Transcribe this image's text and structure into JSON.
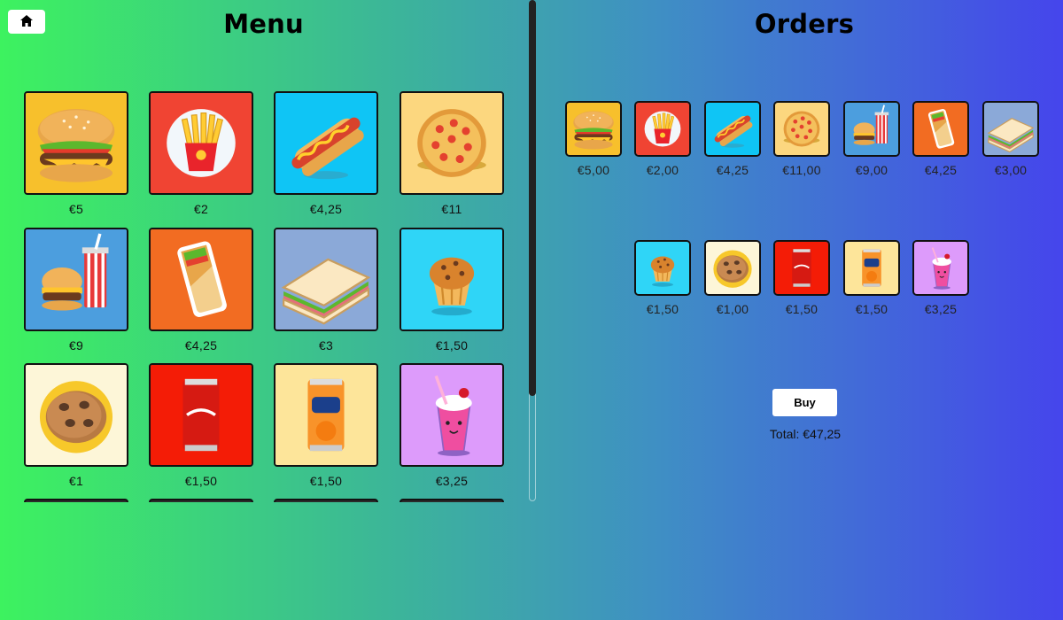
{
  "header": {
    "home_icon": "home-icon"
  },
  "menu": {
    "title": "Menu",
    "items": [
      {
        "name": "burger",
        "icon": "burger-icon",
        "price": "€5",
        "bg": "#f7c02c"
      },
      {
        "name": "fries",
        "icon": "fries-icon",
        "price": "€2",
        "bg": "#f04433"
      },
      {
        "name": "hotdog",
        "icon": "hotdog-icon",
        "price": "€4,25",
        "bg": "#0fc5f5"
      },
      {
        "name": "pizza",
        "icon": "pizza-icon",
        "price": "€11",
        "bg": "#fcd77f"
      },
      {
        "name": "burger-combo",
        "icon": "burger-combo-icon",
        "price": "€9",
        "bg": "#4c9ede"
      },
      {
        "name": "burrito",
        "icon": "burrito-icon",
        "price": "€4,25",
        "bg": "#f26c22"
      },
      {
        "name": "sandwich",
        "icon": "sandwich-icon",
        "price": "€3",
        "bg": "#8ba9d8"
      },
      {
        "name": "muffin",
        "icon": "muffin-icon",
        "price": "€1,50",
        "bg": "#2fd5f7"
      },
      {
        "name": "cookie",
        "icon": "cookie-icon",
        "price": "€1",
        "bg": "#fdf6d8"
      },
      {
        "name": "cola",
        "icon": "cola-can-icon",
        "price": "€1,50",
        "bg": "#f41c06"
      },
      {
        "name": "fanta",
        "icon": "fanta-can-icon",
        "price": "€1,50",
        "bg": "#fde59a"
      },
      {
        "name": "milkshake",
        "icon": "milkshake-icon",
        "price": "€3,25",
        "bg": "#dd9bfb"
      }
    ]
  },
  "orders": {
    "title": "Orders",
    "items": [
      {
        "name": "burger",
        "icon": "burger-icon",
        "price": "€5,00",
        "bg": "#f7c02c"
      },
      {
        "name": "fries",
        "icon": "fries-icon",
        "price": "€2,00",
        "bg": "#f04433"
      },
      {
        "name": "hotdog",
        "icon": "hotdog-icon",
        "price": "€4,25",
        "bg": "#0fc5f5"
      },
      {
        "name": "pizza",
        "icon": "pizza-icon",
        "price": "€11,00",
        "bg": "#fcd77f"
      },
      {
        "name": "burger-combo",
        "icon": "burger-combo-icon",
        "price": "€9,00",
        "bg": "#4c9ede"
      },
      {
        "name": "burrito",
        "icon": "burrito-icon",
        "price": "€4,25",
        "bg": "#f26c22"
      },
      {
        "name": "sandwich",
        "icon": "sandwich-icon",
        "price": "€3,00",
        "bg": "#8ba9d8"
      },
      {
        "name": "muffin",
        "icon": "muffin-icon",
        "price": "€1,50",
        "bg": "#2fd5f7"
      },
      {
        "name": "cookie",
        "icon": "cookie-icon",
        "price": "€1,00",
        "bg": "#fdf6d8"
      },
      {
        "name": "cola",
        "icon": "cola-can-icon",
        "price": "€1,50",
        "bg": "#f41c06"
      },
      {
        "name": "fanta",
        "icon": "fanta-can-icon",
        "price": "€1,50",
        "bg": "#fde59a"
      },
      {
        "name": "milkshake",
        "icon": "milkshake-icon",
        "price": "€3,25",
        "bg": "#dd9bfb"
      }
    ],
    "buy_label": "Buy",
    "total_label": "Total: €47,25"
  }
}
